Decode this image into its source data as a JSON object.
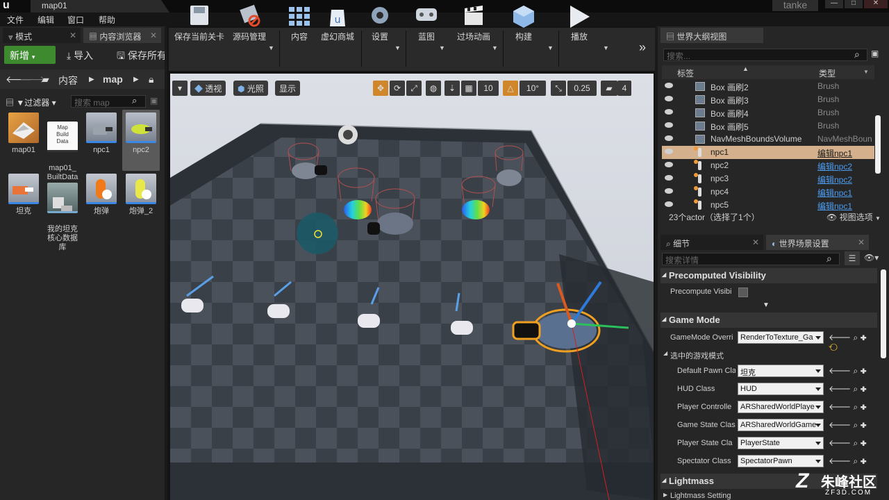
{
  "window": {
    "tab_title": "map01",
    "user_tag": "tanke",
    "logo": "u",
    "min": "—",
    "max": "□",
    "close": "✕"
  },
  "menu": [
    "文件",
    "编辑",
    "窗口",
    "帮助"
  ],
  "left_panel": {
    "tabs": [
      {
        "label": "模式",
        "icon": "modes-icon"
      },
      {
        "label": "内容浏览器",
        "icon": "content-browser-icon"
      }
    ],
    "new_button": "新增",
    "import_button": "导入",
    "save_all_button": "保存所有",
    "breadcrumb": [
      "内容",
      "map"
    ],
    "filter_label": "过滤器",
    "search_placeholder": "搜索 map",
    "assets": [
      {
        "label": "map01",
        "kind": "level"
      },
      {
        "label": "map01_\nBuiltData",
        "kind": "data",
        "thumb_text": "Map\nBuild\nData"
      },
      {
        "label": "npc1",
        "kind": "blueprint"
      },
      {
        "label": "npc2",
        "kind": "blueprint",
        "selected": true
      },
      {
        "label": "坦克",
        "kind": "blueprint"
      },
      {
        "label": "我的坦克\n核心数据\n库",
        "kind": "data"
      },
      {
        "label": "炮弹",
        "kind": "projectile"
      },
      {
        "label": "炮弹_2",
        "kind": "projectile"
      }
    ]
  },
  "toolbar": {
    "buttons": [
      {
        "label": "保存当前关卡",
        "icon": "save-icon"
      },
      {
        "label": "源码管理",
        "icon": "source-control-icon"
      },
      {
        "label": "内容",
        "icon": "content-icon"
      },
      {
        "label": "虚幻商城",
        "icon": "marketplace-icon"
      },
      {
        "label": "设置",
        "icon": "settings-icon"
      },
      {
        "label": "蓝图",
        "icon": "blueprint-icon"
      },
      {
        "label": "过场动画",
        "icon": "cinematics-icon"
      },
      {
        "label": "构建",
        "icon": "build-icon"
      },
      {
        "label": "播放",
        "icon": "play-icon"
      }
    ],
    "more": "»"
  },
  "viewport": {
    "perspective_label": "透视",
    "lit_label": "光照",
    "show_label": "显示",
    "grid_snap": "10",
    "rotation_snap": "10°",
    "scale_snap": "0.25",
    "camera_speed": "4"
  },
  "outliner": {
    "tab_label": "世界大纲视图",
    "search_placeholder": "搜索...",
    "col_label": "标签",
    "col_type": "类型",
    "rows": [
      {
        "label": "Box 画刷2",
        "type": "Brush",
        "link": false,
        "kind": "brush"
      },
      {
        "label": "Box 画刷3",
        "type": "Brush",
        "link": false,
        "kind": "brush"
      },
      {
        "label": "Box 画刷4",
        "type": "Brush",
        "link": false,
        "kind": "brush"
      },
      {
        "label": "Box 画刷5",
        "type": "Brush",
        "link": false,
        "kind": "brush"
      },
      {
        "label": "NavMeshBoundsVolume",
        "type": "NavMeshBoun",
        "link": false,
        "kind": "brush"
      },
      {
        "label": "npc1",
        "type": "编辑npc1",
        "link": true,
        "kind": "pawn",
        "selected": true
      },
      {
        "label": "npc2",
        "type": "编辑npc2",
        "link": true,
        "kind": "pawn"
      },
      {
        "label": "npc3",
        "type": "编辑npc2",
        "link": true,
        "kind": "pawn"
      },
      {
        "label": "npc4",
        "type": "编辑npc1",
        "link": true,
        "kind": "pawn"
      },
      {
        "label": "npc5",
        "type": "编辑npc1",
        "link": true,
        "kind": "pawn"
      }
    ],
    "status": "23个actor（选择了1个）",
    "view_options": "视图选项"
  },
  "details": {
    "tabs": [
      {
        "label": "细节",
        "icon": "details-icon"
      },
      {
        "label": "世界场景设置",
        "icon": "world-settings-icon"
      }
    ],
    "search_placeholder": "搜索详情",
    "precomputed_header": "Precomputed Visibility",
    "precompute_label": "Precompute Visibi",
    "gamemode_header": "Game Mode",
    "gamemode_override_label": "GameMode Overri",
    "gamemode_override_value": "RenderToTexture_Ga",
    "selected_mode_label": "选中的游戏模式",
    "props": [
      {
        "label": "Default Pawn Cla",
        "value": "坦克"
      },
      {
        "label": "HUD Class",
        "value": "HUD"
      },
      {
        "label": "Player Controlle",
        "value": "ARSharedWorldPlaye"
      },
      {
        "label": "Game State Clas",
        "value": "ARSharedWorldGame"
      },
      {
        "label": "Player State Cla",
        "value": "PlayerState"
      },
      {
        "label": "Spectator Class",
        "value": "SpectatorPawn"
      }
    ],
    "lightmass_header": "Lightmass",
    "lightmass_settings": "Lightmass Setting"
  },
  "watermark": {
    "brand": "朱峰社区",
    "site": "ZF3D.COM"
  },
  "colors": {
    "accent_green": "#3d8b2e",
    "selection": "#d4b18c",
    "link": "#4c9cf0",
    "active_orange": "#d0862a"
  }
}
